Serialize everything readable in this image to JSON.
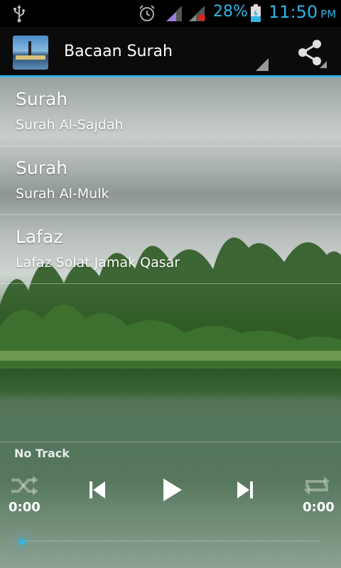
{
  "status_bar": {
    "battery_percent": "28%",
    "time": "11:50",
    "ampm": "PM",
    "accent_color": "#33b5e5",
    "icons": [
      "usb-icon",
      "alarm-icon",
      "signal-icon",
      "signal-icon",
      "battery-charging-icon"
    ]
  },
  "action_bar": {
    "title": "Bacaan Surah",
    "icons": [
      "app-icon",
      "share-icon"
    ]
  },
  "list": {
    "items": [
      {
        "heading": "Surah",
        "subtitle": "Surah Al-Sajdah"
      },
      {
        "heading": "Surah",
        "subtitle": "Surah Al-Mulk"
      },
      {
        "heading": "Lafaz",
        "subtitle": "Lafaz Solat Jamak Qasar"
      }
    ]
  },
  "player": {
    "track_title": "No Track",
    "elapsed": "0:00",
    "duration": "0:00",
    "progress": 0,
    "icons": [
      "shuffle-icon",
      "previous-icon",
      "play-icon",
      "next-icon",
      "repeat-icon"
    ]
  }
}
